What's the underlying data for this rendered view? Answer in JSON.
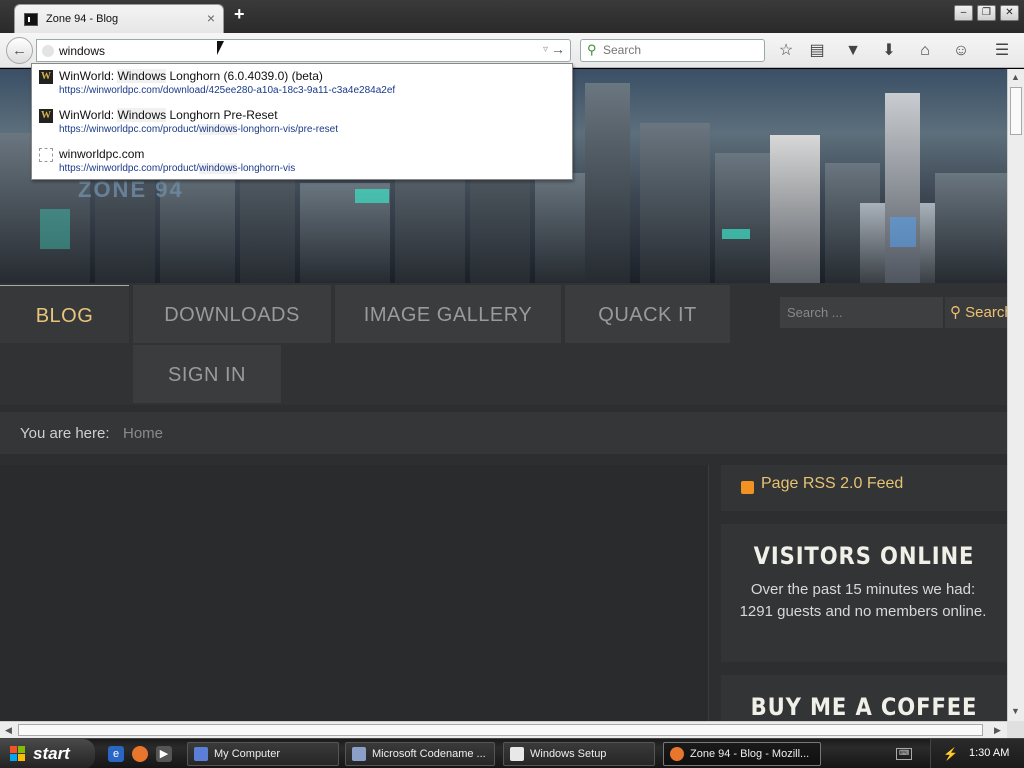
{
  "browser": {
    "tab_title": "Zone 94 - Blog",
    "tab_close": "×",
    "new_tab": "+",
    "window_controls": {
      "minimize": "–",
      "maximize": "❐",
      "close": "✕"
    },
    "back_icon": "arrow-left-icon",
    "url_value": "windows",
    "search_placeholder": "Search"
  },
  "autocomplete": [
    {
      "title_pre": "WinWorld: ",
      "title_match": "Windows",
      "title_post": " Longhorn (6.0.4039.0) (beta)",
      "url_pre": "https://winworldpc.com/download/425ee280-a10a-18c3-9a11-c3a4e284a2ef",
      "url_match": "",
      "url_post": "",
      "icon": "W"
    },
    {
      "title_pre": "WinWorld: ",
      "title_match": "Windows",
      "title_post": " Longhorn Pre-Reset",
      "url_pre": "https://winworldpc.com/product/",
      "url_match": "windows",
      "url_post": "-longhorn-vis/pre-reset",
      "icon": "W"
    },
    {
      "title_pre": "winworldpc.com",
      "title_match": "",
      "title_post": "",
      "url_pre": "https://winworldpc.com/product/",
      "url_match": "windows",
      "url_post": "-longhorn-vis",
      "icon": ""
    }
  ],
  "site": {
    "logo_text": "ZONE 94",
    "menu": [
      {
        "label": "BLOG",
        "active": true
      },
      {
        "label": "DOWNLOADS"
      },
      {
        "label": "IMAGE GALLERY"
      },
      {
        "label": "QUACK IT"
      },
      {
        "label": "SIGN IN"
      }
    ],
    "search_placeholder": "Search ...",
    "search_button": "Search",
    "breadcrumb_label": "You are here:",
    "breadcrumb_home": "Home",
    "rss_text": "Page RSS 2.0 Feed",
    "visitors_heading": "VISITORS ONLINE",
    "visitors_text": "Over the past 15 minutes we had: 1291 guests and no members online.",
    "coffee_heading": "BUY ME A COFFEE"
  },
  "taskbar": {
    "start_label": "start",
    "items": [
      {
        "label": "My Computer",
        "color": "#5b7fd6"
      },
      {
        "label": "Microsoft Codename ...",
        "color": "#8aa0c8"
      },
      {
        "label": "Windows Setup",
        "color": "#e8e8e8"
      },
      {
        "label": "Zone 94 - Blog - Mozill...",
        "color": "#e8762c",
        "active": true
      }
    ],
    "clock": "1:30 AM"
  },
  "colors": {
    "accent": "#e8c57a",
    "page_bg": "#2d2e30",
    "rss": "#f29222"
  }
}
